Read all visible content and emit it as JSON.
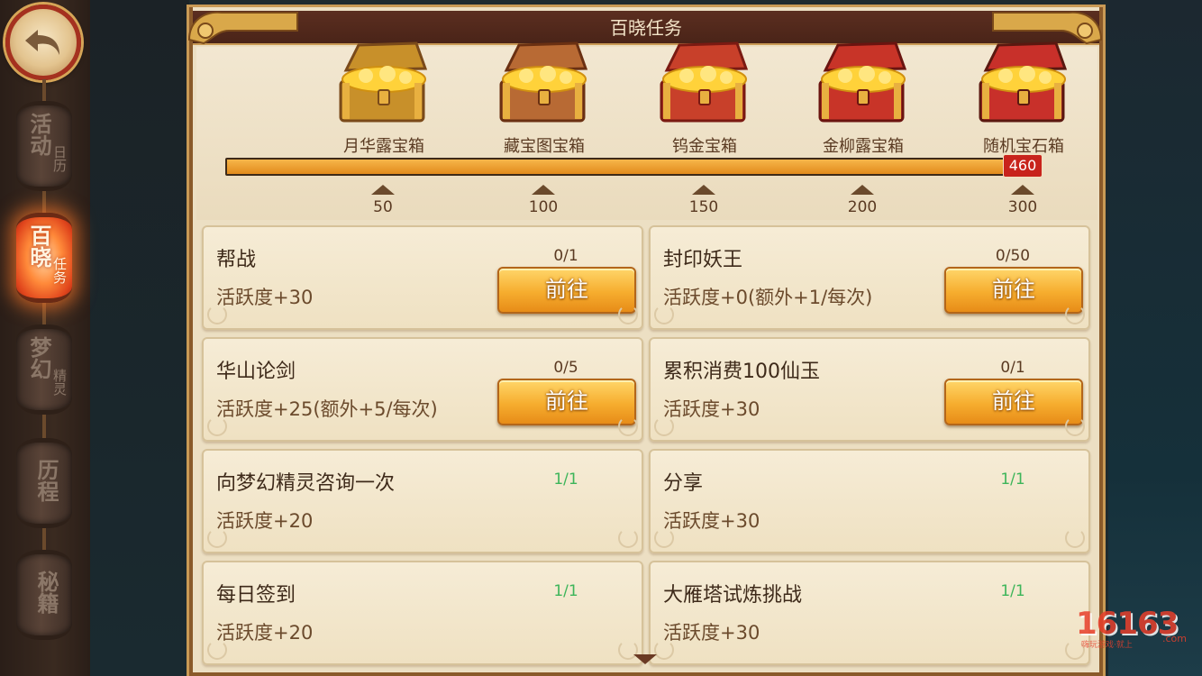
{
  "title": "百晓任务",
  "sidebar": {
    "tabs": [
      {
        "big": "活动",
        "small": "日历",
        "active": false
      },
      {
        "big": "百晓",
        "small": "任务",
        "active": true
      },
      {
        "big": "梦幻",
        "small": "精灵",
        "active": false
      },
      {
        "big": "历程",
        "small": "",
        "active": false
      },
      {
        "big": "秘籍",
        "small": "",
        "active": false
      }
    ]
  },
  "rewards": {
    "chests": [
      {
        "label": "月华露宝箱",
        "milestone": "50",
        "icon": "treasure-chest-wood-icon"
      },
      {
        "label": "藏宝图宝箱",
        "milestone": "100",
        "icon": "treasure-chest-brown-icon"
      },
      {
        "label": "钨金宝箱",
        "milestone": "150",
        "icon": "treasure-chest-red-icon"
      },
      {
        "label": "金柳露宝箱",
        "milestone": "200",
        "icon": "treasure-chest-red-gold-icon"
      },
      {
        "label": "随机宝石箱",
        "milestone": "300",
        "icon": "treasure-chest-gem-icon"
      }
    ],
    "activity_value": "460",
    "progress_fraction": 1.0
  },
  "tasks": [
    {
      "name": "帮战",
      "progress": "0/1",
      "reward": "活跃度+30",
      "button": "前往",
      "done": false
    },
    {
      "name": "封印妖王",
      "progress": "0/50",
      "reward": "活跃度+0(额外+1/每次)",
      "button": "前往",
      "done": false
    },
    {
      "name": "华山论剑",
      "progress": "0/5",
      "reward": "活跃度+25(额外+5/每次)",
      "button": "前往",
      "done": false
    },
    {
      "name": "累积消费100仙玉",
      "progress": "0/1",
      "reward": "活跃度+30",
      "button": "前往",
      "done": false
    },
    {
      "name": "向梦幻精灵咨询一次",
      "progress": "1/1",
      "reward": "活跃度+20",
      "button": "",
      "done": true
    },
    {
      "name": "分享",
      "progress": "1/1",
      "reward": "活跃度+30",
      "button": "",
      "done": true
    },
    {
      "name": "每日签到",
      "progress": "1/1",
      "reward": "活跃度+20",
      "button": "",
      "done": true
    },
    {
      "name": "大雁塔试炼挑战",
      "progress": "1/1",
      "reward": "活跃度+30",
      "button": "",
      "done": true
    }
  ],
  "watermark": {
    "num": "16163",
    "sub": "嗨玩游戏·就上",
    "com": ".com"
  },
  "colors": {
    "accent": "#f6ad2e",
    "done": "#3db55a",
    "badge": "#c8231c"
  }
}
